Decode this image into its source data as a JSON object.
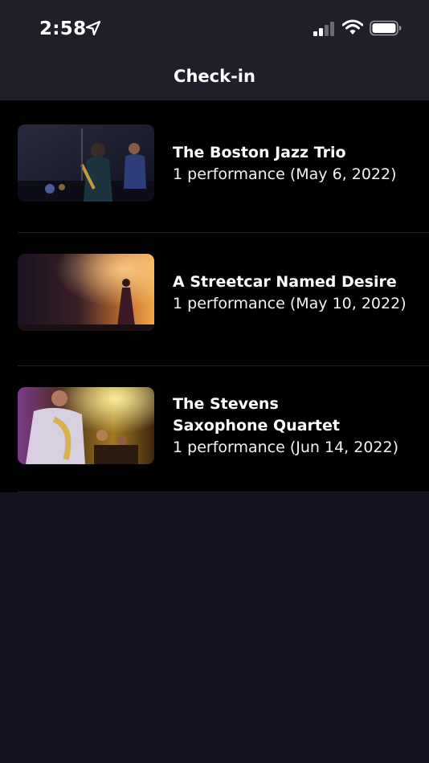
{
  "status_bar": {
    "time": "2:58",
    "icons": [
      "location-arrow-icon",
      "cellular-signal-icon",
      "wifi-icon",
      "battery-icon"
    ]
  },
  "nav": {
    "title": "Check-in"
  },
  "colors": {
    "header_bg": "#1f1e29",
    "list_bg": "#000000",
    "page_bg": "#13111f",
    "text": "#ffffff"
  },
  "events": [
    {
      "title": "The Boston Jazz Trio",
      "subtitle": "1 performance (May 6, 2022)",
      "image": "jazz-trio-stage-photo"
    },
    {
      "title": "A Streetcar Named Desire",
      "subtitle": "1 performance (May 10, 2022)",
      "image": "theater-spotlight-photo"
    },
    {
      "title": "The Stevens\nSaxophone Quartet",
      "subtitle": "1 performance (Jun 14, 2022)",
      "image": "saxophone-players-photo"
    }
  ]
}
